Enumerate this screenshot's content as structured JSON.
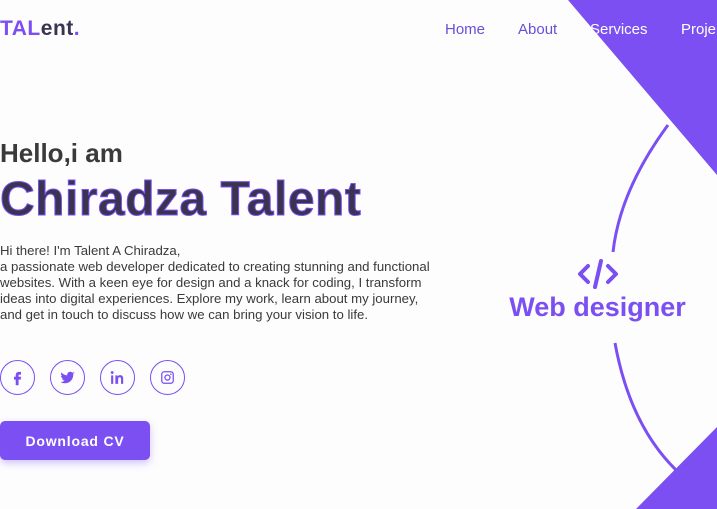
{
  "logo": {
    "accent": "TAL",
    "rest": "ent",
    "dot": "."
  },
  "nav": {
    "home": "Home",
    "about": "About",
    "services": "Services",
    "projects": "Proje"
  },
  "hero": {
    "greeting": "Hello,i am",
    "name": "Chiradza Talent",
    "intro_line1": "Hi there! I'm Talent A Chiradza,",
    "intro_line2": "a passionate web developer dedicated to creating stunning and functional websites. With a keen eye for design and a knack for coding, I transform ideas into digital experiences. Explore my work, learn about my journey, and get in touch to discuss how we can bring your vision to life.",
    "download_label": "Download CV"
  },
  "socials": [
    {
      "icon": "facebook-icon"
    },
    {
      "icon": "twitter-icon"
    },
    {
      "icon": "linkedin-icon"
    },
    {
      "icon": "instagram-icon"
    }
  ],
  "role": {
    "label": "Web designer",
    "icon": "code-icon"
  },
  "colors": {
    "accent": "#7b4ff1",
    "text_dark": "#3b3450",
    "background": "#fdfdfe"
  }
}
